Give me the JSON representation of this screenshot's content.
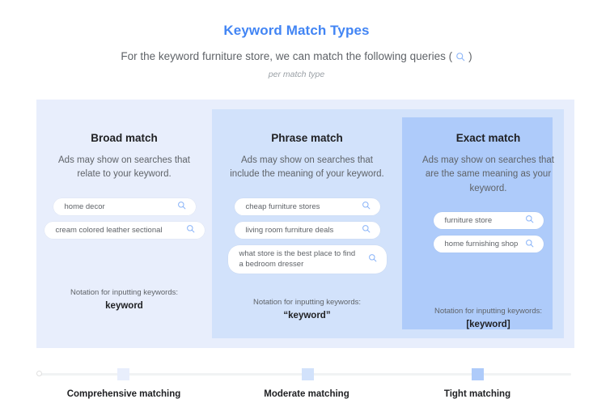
{
  "header": {
    "title": "Keyword Match Types",
    "subtitle_before": "For the keyword furniture store, we can match the following queries (",
    "subtitle_after": ")",
    "subtitle_icon": "search-icon",
    "note": "per match type"
  },
  "columns": [
    {
      "key": "broad",
      "title": "Broad match",
      "description": "Ads may show on searches that relate to your keyword.",
      "queries": [
        "home decor",
        "cream colored leather sectional"
      ],
      "notation_label": "Notation for inputting keywords:",
      "notation_value": "keyword",
      "panel_color": "#e8eefc"
    },
    {
      "key": "phrase",
      "title": "Phrase match",
      "description": "Ads may show on searches that include the meaning of your keyword.",
      "queries": [
        "cheap furniture stores",
        "living room furniture deals",
        "what store is the best place to find a bedroom dresser"
      ],
      "notation_label": "Notation for inputting keywords:",
      "notation_value": "“keyword”",
      "panel_color": "#d2e2fb"
    },
    {
      "key": "exact",
      "title": "Exact match",
      "description": "Ads may show on searches that are the same meaning as your keyword.",
      "queries": [
        "furniture store",
        "home furnishing shop"
      ],
      "notation_label": "Notation for inputting keywords:",
      "notation_value": "[keyword]",
      "panel_color": "#aecbfa"
    }
  ],
  "timeline": {
    "markers": [
      {
        "label": "Comprehensive matching",
        "color": "#e8eefc"
      },
      {
        "label": "Moderate matching",
        "color": "#d2e2fb"
      },
      {
        "label": "Tight matching",
        "color": "#aecbfa"
      }
    ]
  },
  "colors": {
    "title_blue": "#4285F4",
    "search_icon_blue": "#8ab4f8",
    "body_text": "#5f6368",
    "heading_text": "#202124"
  }
}
